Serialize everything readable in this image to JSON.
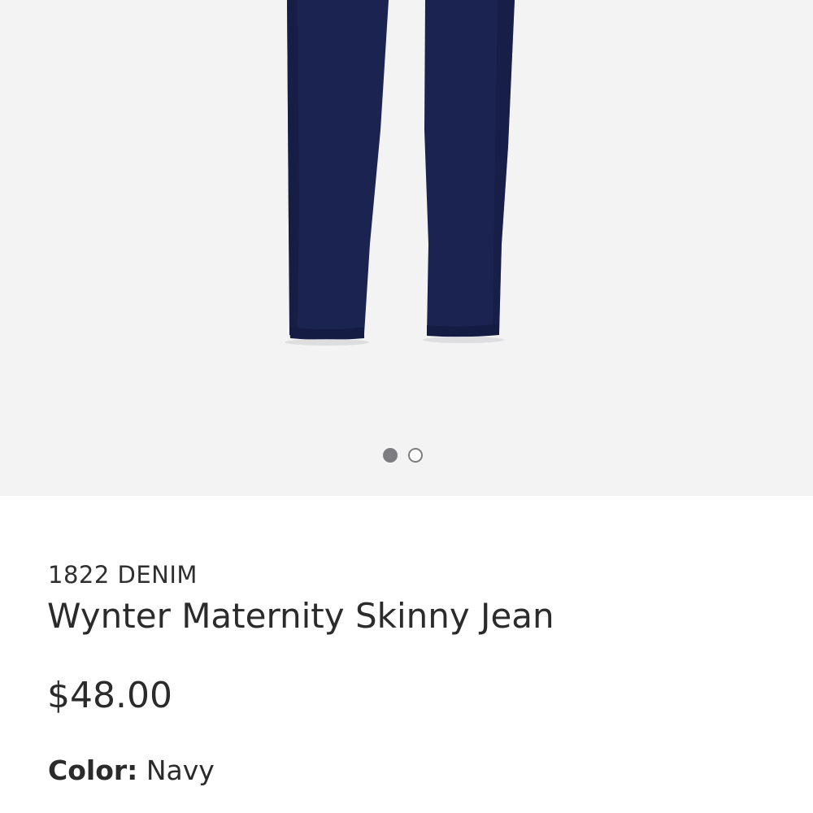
{
  "product": {
    "brand": "1822 DENIM",
    "name": "Wynter Maternity Skinny Jean",
    "price": "$48.00",
    "color_label": "Color:",
    "color_value": "Navy"
  },
  "carousel": {
    "total_images": 2,
    "active_index": 0
  },
  "colors": {
    "image_background": "#f3f3f4",
    "denim": "#1b2350",
    "dot_gray": "#7d7d80"
  }
}
